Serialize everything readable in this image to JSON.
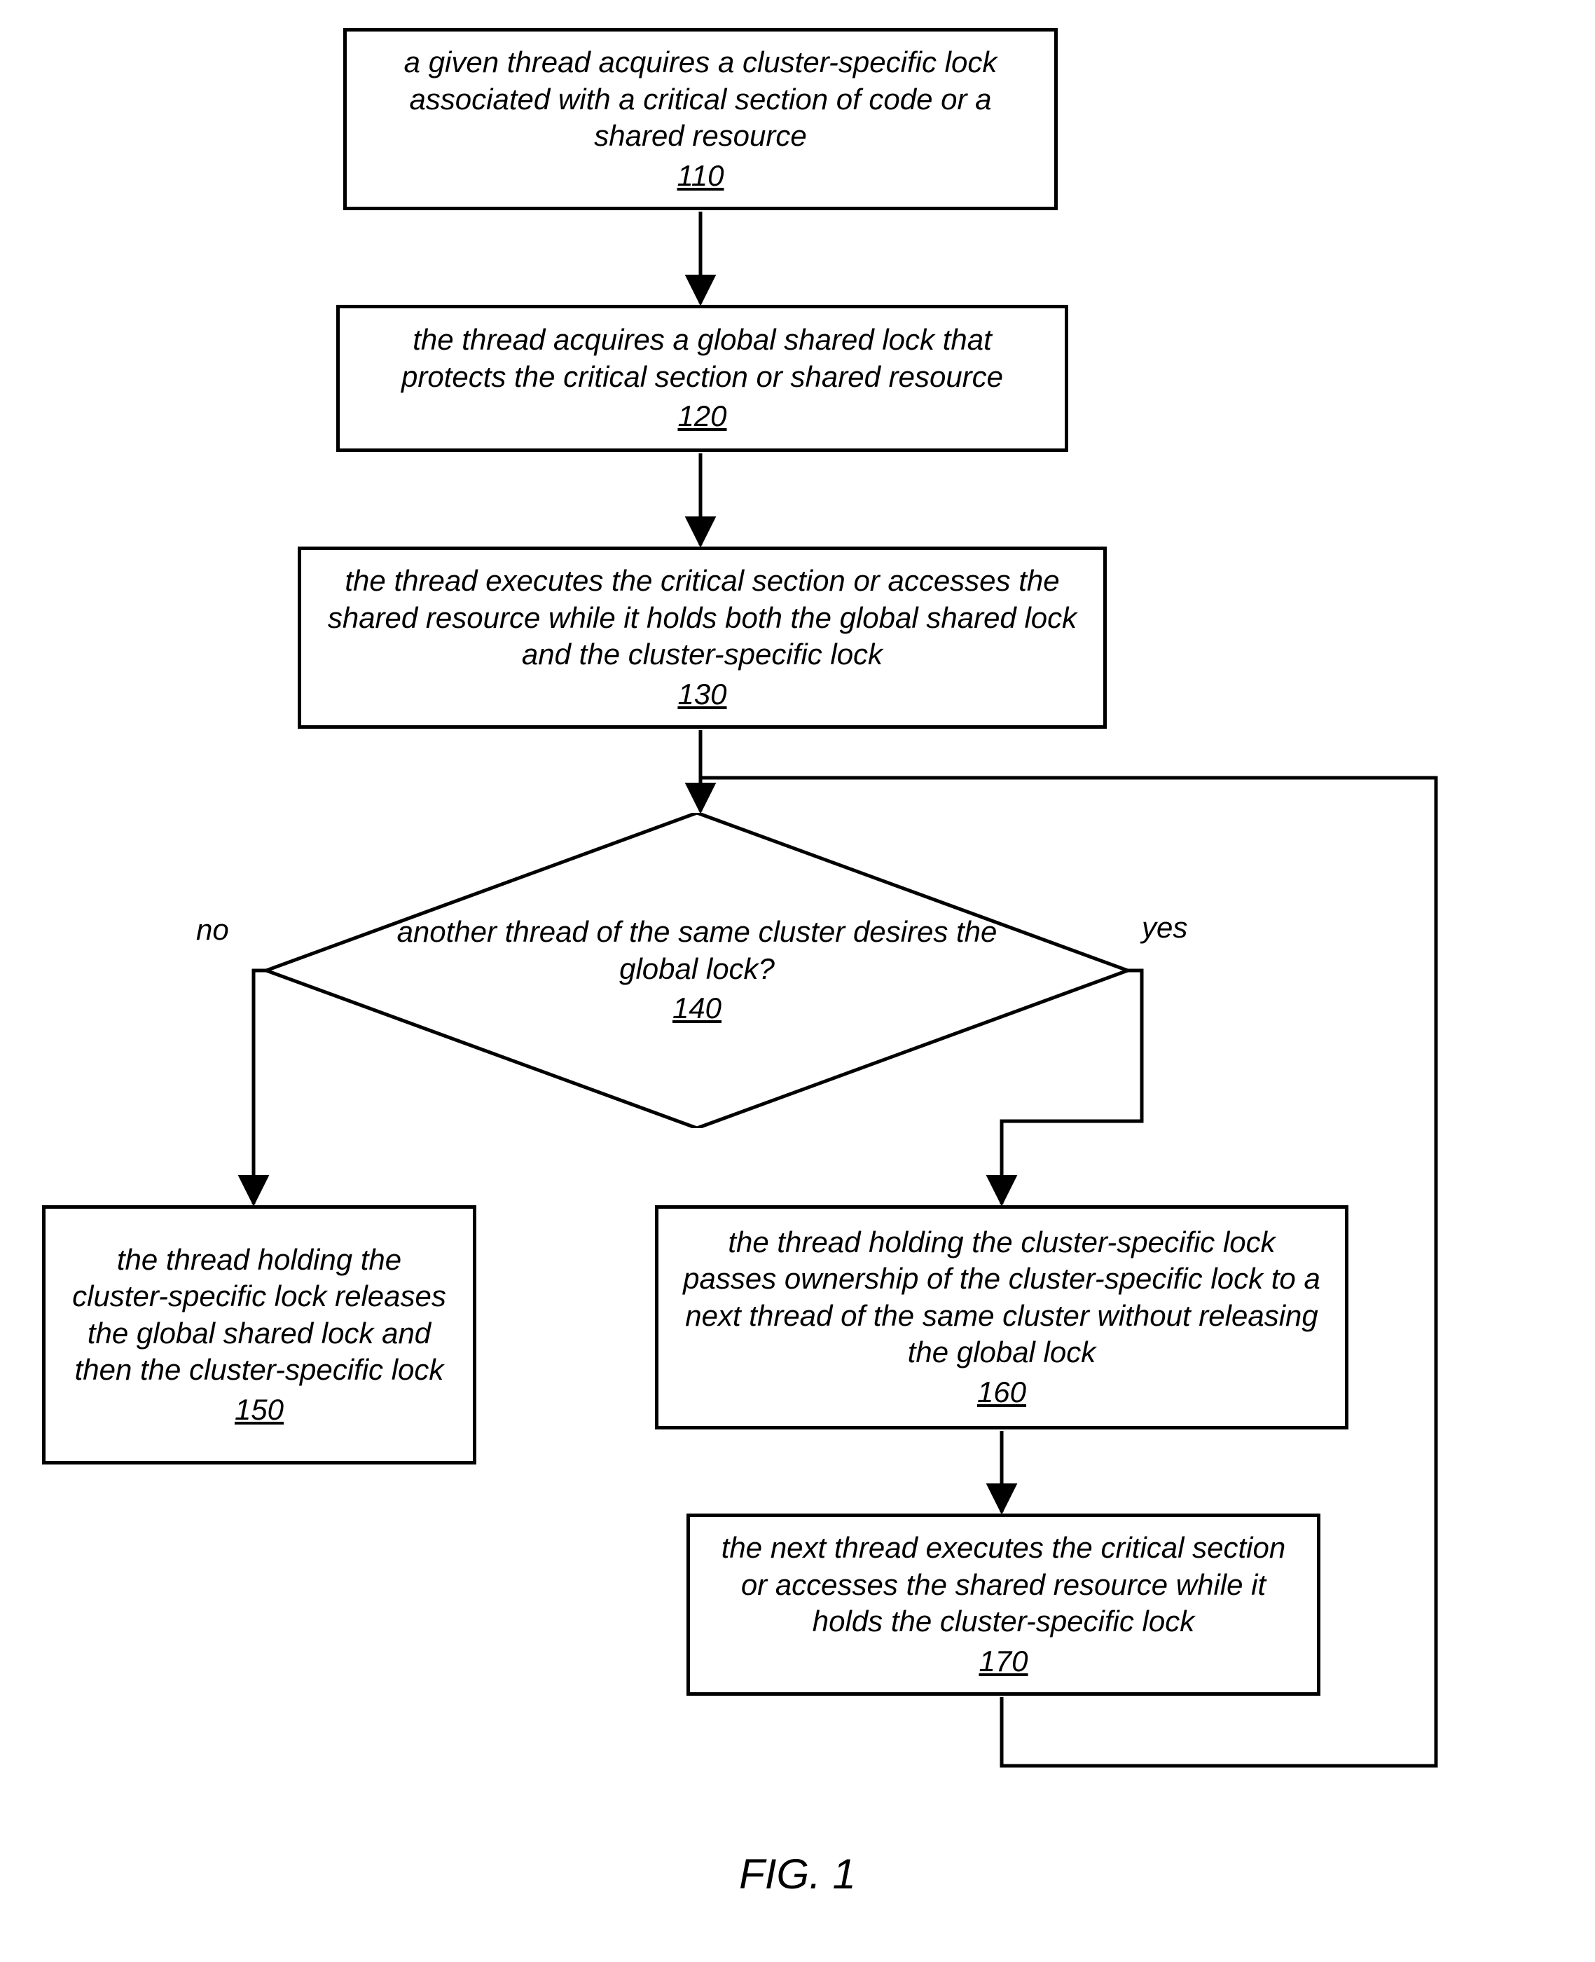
{
  "nodes": {
    "n110": {
      "text": "a given thread acquires a cluster-specific lock associated with a critical section of code or a shared resource",
      "ref": "110"
    },
    "n120": {
      "text": "the thread acquires a global shared lock that protects the critical section or shared resource",
      "ref": "120"
    },
    "n130": {
      "text": "the thread executes the critical section or accesses the shared resource while it holds both the global shared lock and the cluster-specific lock",
      "ref": "130"
    },
    "n140": {
      "text": "another thread of the same cluster desires the global lock?",
      "ref": "140"
    },
    "n150": {
      "text": "the thread holding the cluster-specific lock releases the global shared lock and then the cluster-specific lock",
      "ref": "150"
    },
    "n160": {
      "text": "the thread holding the cluster-specific lock passes ownership of the cluster-specific lock to a next thread of the same cluster without releasing the global lock",
      "ref": "160"
    },
    "n170": {
      "text": "the next thread executes the critical section or accesses the shared resource while it holds the cluster-specific lock",
      "ref": "170"
    }
  },
  "edgeLabels": {
    "no": "no",
    "yes": "yes"
  },
  "figure": "FIG. 1"
}
